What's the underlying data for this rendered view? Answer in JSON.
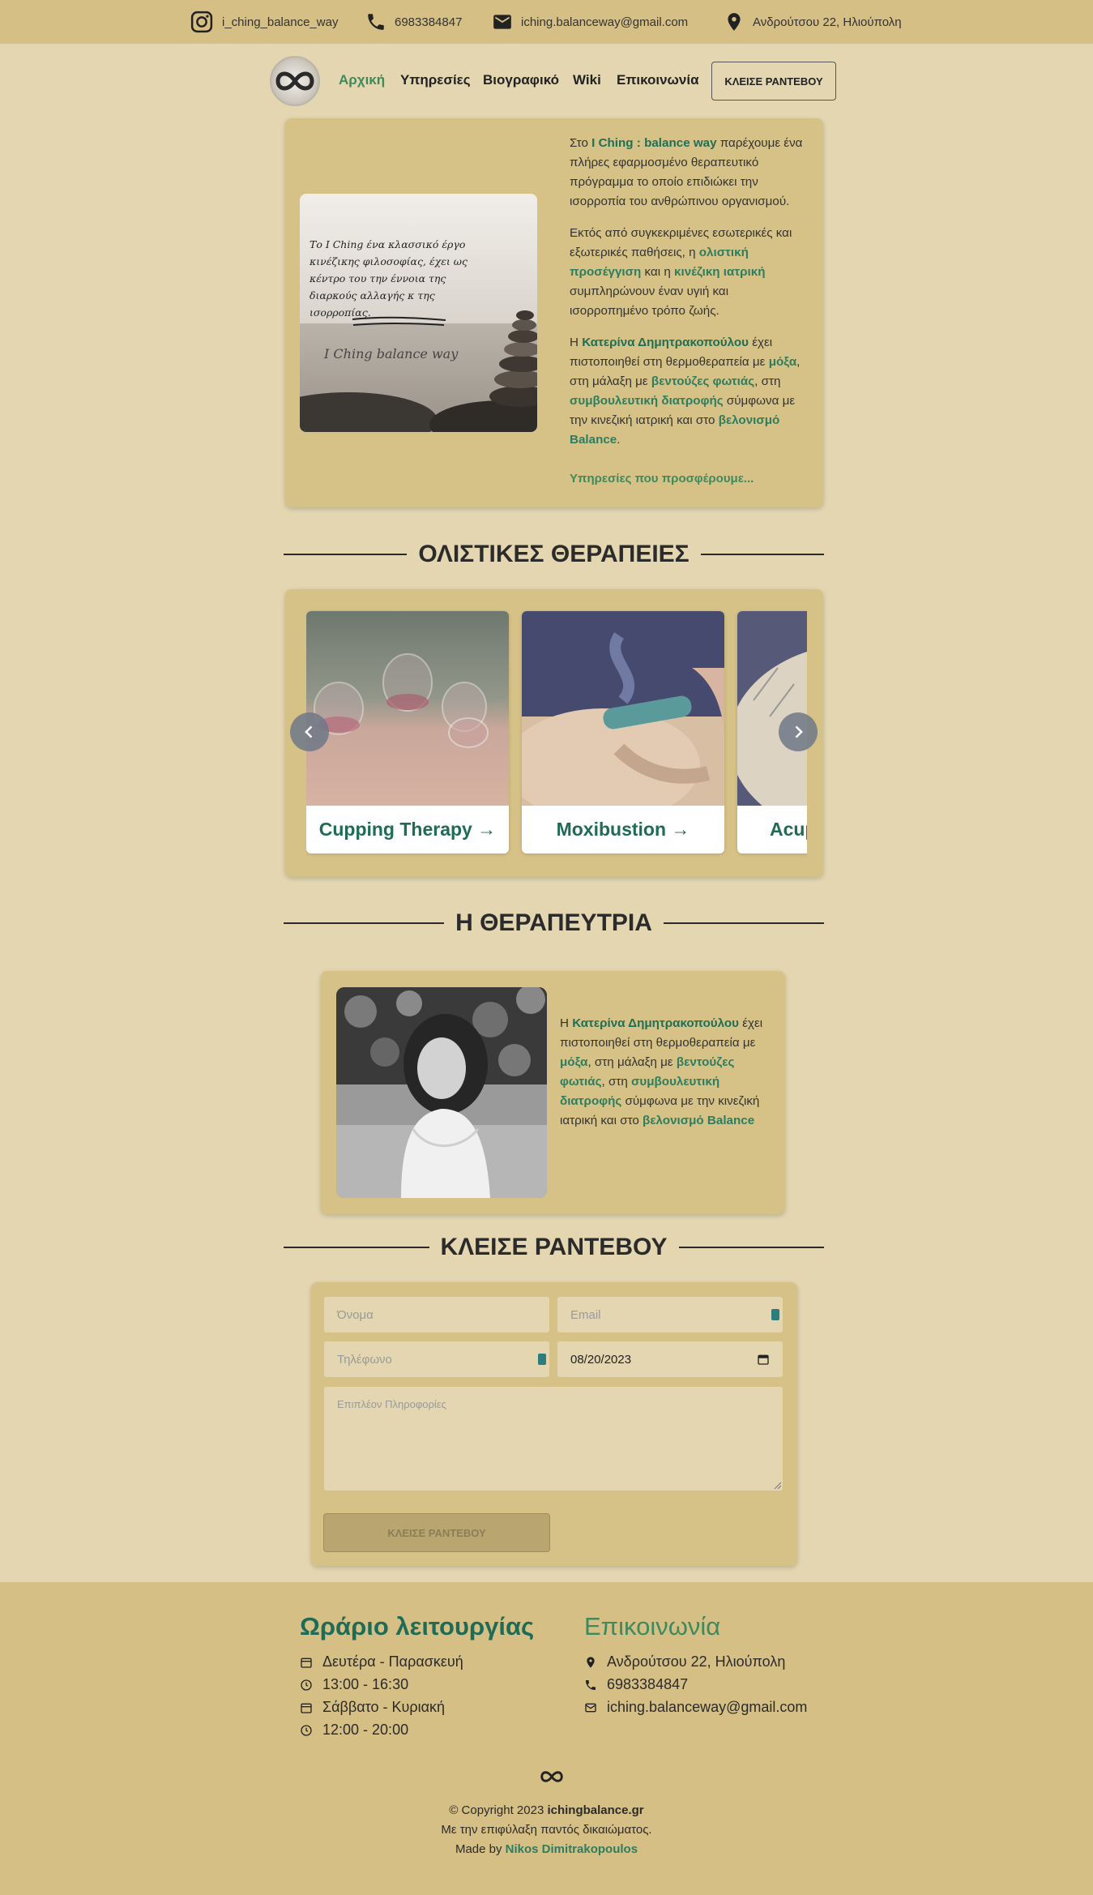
{
  "topbar": {
    "instagram": "i_ching_balance_way",
    "phone": "6983384847",
    "email": "iching.balanceway@gmail.com",
    "address": "Ανδρούτσου 22, Ηλιούπολη"
  },
  "nav": {
    "items": [
      "Αρχική",
      "Υπηρεσίες",
      "Βιογραφικό",
      "Wiki",
      "Επικοινωνία"
    ],
    "book_button": "ΚΛΕΙΣΕ ΡΑΝΤΕΒΟΥ"
  },
  "intro": {
    "image_quote": "Το I Ching ένα κλασσικό έργο κινέζικης φιλοσοφίας, έχει ως κέντρο του την έννοια της διαρκούς αλλαγής κ της ισορροπίας.",
    "image_signature": "I Ching balance way",
    "p1_a": "Στο ",
    "p1_b": "I Ching : balance way",
    "p1_c": " παρέχουμε ένα πλήρες εφαρμοσμένο θεραπευτικό πρόγραμμα το οποίο επιδιώκει την ισορροπία του ανθρώπινου οργανισμού.",
    "p2_a": "Εκτός από συγκεκριμένες εσωτερικές και εξωτερικές παθήσεις, η ",
    "p2_b": "ολιστική προσέγγιση",
    "p2_c": " και η ",
    "p2_d": "κινέζικη ιατρική",
    "p2_e": " συμπληρώνουν έναν υγιή και ισορροπημένο τρόπο ζωής.",
    "p3_a": "Η ",
    "p3_b": "Κατερίνα Δημητρακοπούλου",
    "p3_c": " έχει πιστοποιηθεί στη θερμοθεραπεία με ",
    "p3_d": "μόξα",
    "p3_e": ", στη μάλαξη με ",
    "p3_f": "βεντούζες φωτιάς",
    "p3_g": ", στη ",
    "p3_h": "συμβουλευτική διατροφής",
    "p3_i": " σύμφωνα με την κινεζική ιατρική και στο ",
    "p3_j": "βελονισμό Balance",
    "p3_k": ".",
    "more_link": "Υπηρεσίες που προσφέρουμε..."
  },
  "therapies": {
    "heading": "ΟΛΙΣΤΙΚΕΣ ΘΕΡΑΠΕΙΕΣ",
    "items": [
      "Cupping Therapy",
      "Moxibustion",
      "Acup"
    ]
  },
  "therapist": {
    "heading": "Η ΘΕΡΑΠΕΥΤΡΙΑ",
    "t_a": "Η ",
    "t_b": "Κατερίνα Δημητρακοπούλου",
    "t_c": " έχει πιστοποιηθεί στη θερμοθεραπεία με ",
    "t_d": "μόξα",
    "t_e": ", στη μάλαξη με ",
    "t_f": "βεντούζες φωτιάς",
    "t_g": ", στη ",
    "t_h": "συμβουλευτική διατροφής",
    "t_i": " σύμφωνα με την κινεζική ιατρική και στο ",
    "t_j": "βελονισμό Balance"
  },
  "booking": {
    "heading": "ΚΛΕΙΣΕ ΡΑΝΤΕΒΟΥ",
    "name_placeholder": "Όνομα",
    "email_placeholder": "Email",
    "phone_placeholder": "Τηλέφωνο",
    "date_value": "08/20/2023",
    "info_placeholder": "Επιπλέον Πληροφορίες",
    "submit": "ΚΛΕΙΣΕ ΡΑΝΤΕΒΟΥ"
  },
  "footer": {
    "hours_title": "Ωράριο λειτουργίας",
    "hours": [
      "Δευτέρα - Παρασκευή",
      "13:00 - 16:30",
      "Σάββατο - Κυριακή",
      "12:00 - 20:00"
    ],
    "contact_title": "Επικοινωνία",
    "address": "Ανδρούτσου 22, Ηλιούπολη",
    "phone": "6983384847",
    "email": "iching.balanceway@gmail.com",
    "copyright_a": "© Copyright 2023 ",
    "copyright_b": "ichingbalance.gr",
    "rights": "Με την επιφύλαξη παντός δικαιώματος.",
    "made_by_a": "Made by ",
    "made_by_b": "Nikos Dimitrakopoulos"
  },
  "colors": {
    "page_bg": "#e3d6b0",
    "bar_bg": "#d5bf85",
    "card_bg": "#d6c286",
    "accent_green": "#2d7d5f",
    "nav_active": "#3f8a5c"
  }
}
